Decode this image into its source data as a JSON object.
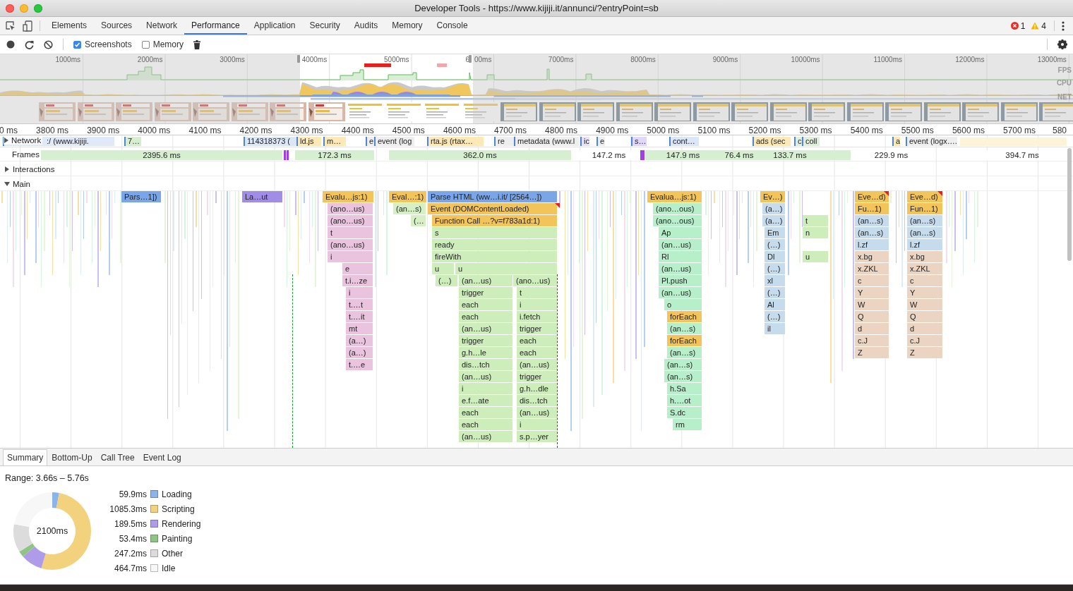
{
  "window": {
    "title": "Developer Tools - https://www.kijiji.it/annunci/?entryPoint=sb"
  },
  "panel_tabs": [
    {
      "label": "Elements",
      "selected": false
    },
    {
      "label": "Sources",
      "selected": false
    },
    {
      "label": "Network",
      "selected": false
    },
    {
      "label": "Performance",
      "selected": true
    },
    {
      "label": "Application",
      "selected": false
    },
    {
      "label": "Security",
      "selected": false
    },
    {
      "label": "Audits",
      "selected": false
    },
    {
      "label": "Memory",
      "selected": false
    },
    {
      "label": "Console",
      "selected": false
    }
  ],
  "issues": [
    {
      "kind": "error",
      "count": "1"
    },
    {
      "kind": "warning",
      "count": "4"
    }
  ],
  "toolbar": {
    "options": [
      {
        "label": "Screenshots",
        "checked": true
      },
      {
        "label": "Memory",
        "checked": false
      }
    ]
  },
  "overview": {
    "ticks": [
      "1000ms",
      "2000ms",
      "3000ms",
      "4000ms",
      "5000ms",
      "6",
      "00ms",
      "7000ms",
      "8000ms",
      "9000ms",
      "10000ms",
      "11000ms",
      "12000ms",
      "13000ms"
    ],
    "tracks": [
      "FPS",
      "CPU",
      "NET"
    ]
  },
  "ruler": [
    "0 ms",
    "3800 ms",
    "3900 ms",
    "4000 ms",
    "4100 ms",
    "4200 ms",
    "4300 ms",
    "4400 ms",
    "4500 ms",
    "4600 ms",
    "4700 ms",
    "4800 ms",
    "4900 ms",
    "5000 ms",
    "5100 ms",
    "5200 ms",
    "5300 ms",
    "5400 ms",
    "5500 ms",
    "5600 ms",
    "5700 ms",
    "580"
  ],
  "network": {
    "label": "Network",
    "expanded": false,
    "requests": [
      ":/ (www.kijiji.",
      "7…",
      "114318373 (",
      "ld.js",
      "m…",
      "e",
      "event (log",
      "rta.js (rtax…",
      "re",
      "metadata (www.l",
      "ic",
      "e",
      "s…",
      "cont…",
      "ads (sec",
      "c",
      "coll",
      "a",
      "event (logx…."
    ]
  },
  "frames": {
    "label": "Frames",
    "items": [
      {
        "duration": "2395.6 ms",
        "kind": "frame"
      },
      {
        "duration": "172.3 ms",
        "kind": "frame"
      },
      {
        "duration": "362.0 ms",
        "kind": "frame"
      },
      {
        "duration": "147.2 ms",
        "kind": "idle"
      },
      {
        "duration": "147.9 ms",
        "kind": "frame"
      },
      {
        "duration": "76.4 ms",
        "kind": "frame"
      },
      {
        "duration": "133.7 ms",
        "kind": "frame"
      },
      {
        "duration": "229.9 ms",
        "kind": "idle"
      },
      {
        "duration": "394.7 ms",
        "kind": "idle"
      }
    ]
  },
  "sections": [
    {
      "label": "Interactions",
      "expanded": false
    },
    {
      "label": "Main",
      "expanded": true
    }
  ],
  "flame_rows": [
    [
      {
        "label": "Pars…1])",
        "color": "#7aa6e8"
      },
      {
        "label": "La…ut",
        "color": "#a08de6"
      },
      {
        "label": "Evalu…js:1)",
        "color": "#f2c45a"
      },
      {
        "label": "Eval…:1)",
        "color": "#f2c45a"
      },
      {
        "label": "Parse HTML (ww…i.it/ [2564…])",
        "color": "#7aa6e8"
      },
      {
        "label": "Evalua…js:1)",
        "color": "#f2c45a"
      },
      {
        "label": "Ev…)",
        "color": "#f2c45a"
      },
      {
        "label": "Eve…d)",
        "color": "#f2c45a"
      },
      {
        "label": "Eve…d)",
        "color": "#f2c45a"
      }
    ],
    [
      {
        "label": "(ano…us)",
        "color": "#eac3df"
      },
      {
        "label": "(an…s)",
        "color": "#d6efc4"
      },
      {
        "label": "Event (DOMContentLoaded)",
        "color": "#f2c45a"
      },
      {
        "label": "(ano…ous)",
        "color": "#b7efca"
      },
      {
        "label": "(a…)",
        "color": "#c6dced"
      },
      {
        "label": "Fu…1)",
        "color": "#f2c45a"
      },
      {
        "label": "Fun…1)",
        "color": "#f2c45a"
      }
    ],
    [
      {
        "label": "(ano…us)",
        "color": "#eac3df"
      },
      {
        "label": "(…",
        "color": "#d6efc4"
      },
      {
        "label": "Function Call …?v=f783a1d:1)",
        "color": "#f2c45a"
      },
      {
        "label": "(ano…ous)",
        "color": "#b7efca"
      },
      {
        "label": "(a…)",
        "color": "#c6dced"
      },
      {
        "label": "t",
        "color": "#cdeebb"
      },
      {
        "label": "(an…s)",
        "color": "#c6dced"
      },
      {
        "label": "(an…s)",
        "color": "#c6dced"
      }
    ],
    [
      {
        "label": "t",
        "color": "#eac3df"
      },
      {
        "label": "s",
        "color": "#cdeebb"
      },
      {
        "label": "Ap",
        "color": "#b7efca"
      },
      {
        "label": "Em",
        "color": "#c6dced"
      },
      {
        "label": "n",
        "color": "#cdeebb"
      },
      {
        "label": "(an…s)",
        "color": "#c6dced"
      },
      {
        "label": "(an…s)",
        "color": "#c6dced"
      }
    ],
    [
      {
        "label": "(ano…us)",
        "color": "#eac3df"
      },
      {
        "label": "ready",
        "color": "#cdeebb"
      },
      {
        "label": "(an…us)",
        "color": "#b7efca"
      },
      {
        "label": "(…)",
        "color": "#c6dced"
      },
      {
        "label": "l.zf",
        "color": "#c6dced"
      },
      {
        "label": "l.zf",
        "color": "#c6dced"
      }
    ],
    [
      {
        "label": "i",
        "color": "#eac3df"
      },
      {
        "label": "fireWith",
        "color": "#cdeebb"
      },
      {
        "label": "Rl",
        "color": "#b7efca"
      },
      {
        "label": "Dl",
        "color": "#c6dced"
      },
      {
        "label": "u",
        "color": "#cdeebb"
      },
      {
        "label": "x.bg",
        "color": "#ebd5c2"
      },
      {
        "label": "x.bg",
        "color": "#ebd5c2"
      }
    ],
    [
      {
        "label": "e",
        "color": "#eac3df"
      },
      {
        "label": "u",
        "color": "#cdeebb"
      },
      {
        "label": "u",
        "color": "#cdeebb"
      },
      {
        "label": "(an…us)",
        "color": "#b7efca"
      },
      {
        "label": "(…)",
        "color": "#c6dced"
      },
      {
        "label": "x.ZKL",
        "color": "#ebd5c2"
      },
      {
        "label": "x.ZKL",
        "color": "#ebd5c2"
      }
    ],
    [
      {
        "label": "t.i…ze",
        "color": "#eac3df"
      },
      {
        "label": "(…)",
        "color": "#cdeebb"
      },
      {
        "label": "(an…us)",
        "color": "#cdeebb"
      },
      {
        "label": "(ano…us)",
        "color": "#cdeebb"
      },
      {
        "label": "Pl.push",
        "color": "#b7efca"
      },
      {
        "label": "xl",
        "color": "#c6dced"
      },
      {
        "label": "c",
        "color": "#ebd5c2"
      },
      {
        "label": "c",
        "color": "#ebd5c2"
      }
    ],
    [
      {
        "label": "i",
        "color": "#eac3df"
      },
      {
        "label": "trigger",
        "color": "#cdeebb"
      },
      {
        "label": "t",
        "color": "#cdeebb"
      },
      {
        "label": "(an…us)",
        "color": "#b7efca"
      },
      {
        "label": "(…)",
        "color": "#c6dced"
      },
      {
        "label": "Y",
        "color": "#ebd5c2"
      },
      {
        "label": "Y",
        "color": "#ebd5c2"
      }
    ],
    [
      {
        "label": "t.…t",
        "color": "#eac3df"
      },
      {
        "label": "each",
        "color": "#cdeebb"
      },
      {
        "label": "i",
        "color": "#cdeebb"
      },
      {
        "label": "o",
        "color": "#b7efca"
      },
      {
        "label": "Al",
        "color": "#c6dced"
      },
      {
        "label": "W",
        "color": "#ebd5c2"
      },
      {
        "label": "W",
        "color": "#ebd5c2"
      }
    ],
    [
      {
        "label": "t.…it",
        "color": "#eac3df"
      },
      {
        "label": "each",
        "color": "#cdeebb"
      },
      {
        "label": "i.fetch",
        "color": "#cdeebb"
      },
      {
        "label": "forEach",
        "color": "#f2c45a"
      },
      {
        "label": "(…)",
        "color": "#c6dced"
      },
      {
        "label": "Q",
        "color": "#ebd5c2"
      },
      {
        "label": "Q",
        "color": "#ebd5c2"
      }
    ],
    [
      {
        "label": "mt",
        "color": "#eac3df"
      },
      {
        "label": "(an…us)",
        "color": "#cdeebb"
      },
      {
        "label": "trigger",
        "color": "#cdeebb"
      },
      {
        "label": "(an…s)",
        "color": "#b7efca"
      },
      {
        "label": "il",
        "color": "#c6dced"
      },
      {
        "label": "d",
        "color": "#ebd5c2"
      },
      {
        "label": "d",
        "color": "#ebd5c2"
      }
    ],
    [
      {
        "label": "(a…)",
        "color": "#eac3df"
      },
      {
        "label": "trigger",
        "color": "#cdeebb"
      },
      {
        "label": "each",
        "color": "#cdeebb"
      },
      {
        "label": "forEach",
        "color": "#f2c45a"
      },
      {
        "label": "c.J",
        "color": "#ebd5c2"
      },
      {
        "label": "c.J",
        "color": "#ebd5c2"
      }
    ],
    [
      {
        "label": "(a…)",
        "color": "#eac3df"
      },
      {
        "label": "g.h…le",
        "color": "#cdeebb"
      },
      {
        "label": "each",
        "color": "#cdeebb"
      },
      {
        "label": "(an…s)",
        "color": "#b7efca"
      },
      {
        "label": "Z",
        "color": "#ebd5c2"
      },
      {
        "label": "Z",
        "color": "#ebd5c2"
      }
    ],
    [
      {
        "label": "t.…e",
        "color": "#eac3df"
      },
      {
        "label": "dis…tch",
        "color": "#cdeebb"
      },
      {
        "label": "(an…us)",
        "color": "#cdeebb"
      },
      {
        "label": "(an…s)",
        "color": "#b7efca"
      }
    ],
    [
      {
        "label": "(an…us)",
        "color": "#cdeebb"
      },
      {
        "label": "trigger",
        "color": "#cdeebb"
      },
      {
        "label": "(an…s)",
        "color": "#b7efca"
      }
    ],
    [
      {
        "label": "i",
        "color": "#cdeebb"
      },
      {
        "label": "g.h…dle",
        "color": "#cdeebb"
      },
      {
        "label": "h.Sa",
        "color": "#b7efca"
      }
    ],
    [
      {
        "label": "e.f…ate",
        "color": "#cdeebb"
      },
      {
        "label": "dis…tch",
        "color": "#cdeebb"
      },
      {
        "label": "h.…ot",
        "color": "#b7efca"
      }
    ],
    [
      {
        "label": "each",
        "color": "#cdeebb"
      },
      {
        "label": "(an…us)",
        "color": "#cdeebb"
      },
      {
        "label": "S.dc",
        "color": "#b7efca"
      }
    ],
    [
      {
        "label": "each",
        "color": "#cdeebb"
      },
      {
        "label": "i",
        "color": "#cdeebb"
      },
      {
        "label": "rm",
        "color": "#b7efca"
      }
    ],
    [
      {
        "label": "(an…us)",
        "color": "#cdeebb"
      },
      {
        "label": "s.p…yer",
        "color": "#cdeebb"
      }
    ]
  ],
  "summary": {
    "tabs": [
      {
        "label": "Summary",
        "selected": true
      },
      {
        "label": "Bottom-Up",
        "selected": false
      },
      {
        "label": "Call Tree",
        "selected": false
      },
      {
        "label": "Event Log",
        "selected": false
      }
    ],
    "range": "Range: 3.66s – 5.76s",
    "total": "2100ms",
    "legend": [
      {
        "time": "59.9ms",
        "color": "#8ab4ea"
      },
      {
        "time": "1085.3ms",
        "color": "#f2d27c"
      },
      {
        "time": "189.5ms",
        "color": "#ae9ce9"
      },
      {
        "time": "53.4ms",
        "color": "#8fc584"
      },
      {
        "time": "247.2ms",
        "color": "#dcdcdc"
      },
      {
        "time": "464.7ms",
        "color": "#f7f7f7"
      }
    ],
    "chart_data": {
      "type": "donut",
      "categories": [
        "Loading",
        "Scripting",
        "Rendering",
        "Painting",
        "Other",
        "Idle"
      ],
      "values": [
        2.85,
        51.68,
        9.02,
        2.54,
        11.77,
        22.14
      ]
    }
  }
}
